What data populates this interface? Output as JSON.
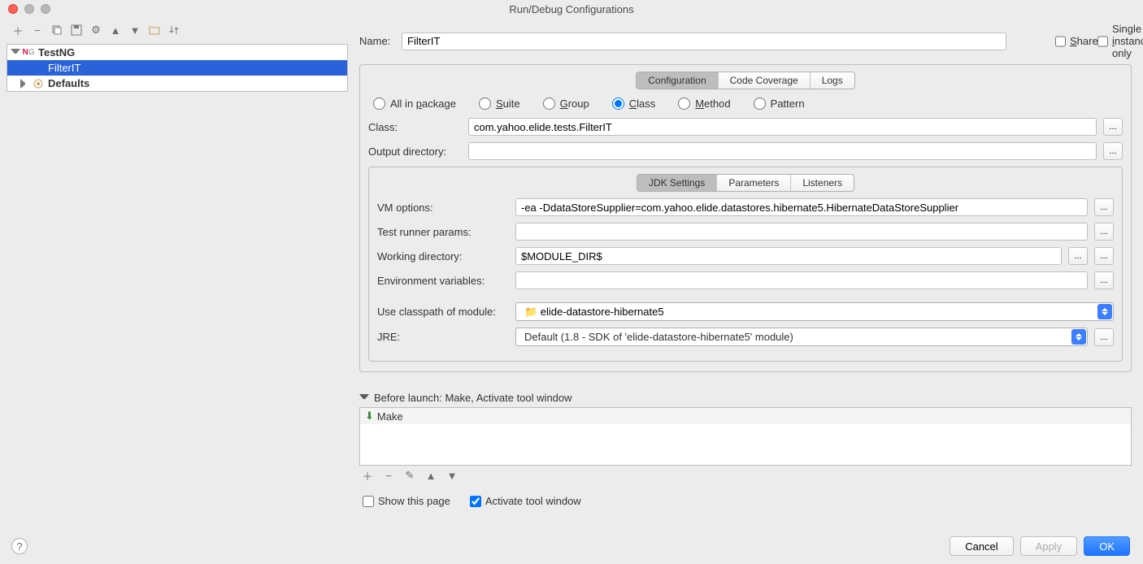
{
  "window": {
    "title": "Run/Debug Configurations"
  },
  "toolbar": {
    "share_label": "Share",
    "single_instance_label": "Single instance only"
  },
  "tree": {
    "root_label": "TestNG",
    "selected_label": "FilterIT",
    "defaults_label": "Defaults"
  },
  "form": {
    "name_label": "Name:",
    "name_value": "FilterIT",
    "tabs": {
      "configuration": "Configuration",
      "code_coverage": "Code Coverage",
      "logs": "Logs"
    },
    "test_kind": {
      "all_in_package": "All in package",
      "suite": "Suite",
      "group": "Group",
      "class": "Class",
      "method": "Method",
      "pattern": "Pattern"
    },
    "class_label": "Class:",
    "class_value": "com.yahoo.elide.tests.FilterIT",
    "output_dir_label": "Output directory:",
    "output_dir_value": "",
    "inner_tabs": {
      "jdk": "JDK Settings",
      "parameters": "Parameters",
      "listeners": "Listeners"
    },
    "vm_label": "VM options:",
    "vm_value": "-ea -DdataStoreSupplier=com.yahoo.elide.datastores.hibernate5.HibernateDataStoreSupplier",
    "runner_label": "Test runner params:",
    "runner_value": "",
    "workdir_label": "Working directory:",
    "workdir_value": "$MODULE_DIR$",
    "env_label": "Environment variables:",
    "env_value": "",
    "classpath_label": "Use classpath of module:",
    "classpath_value": "elide-datastore-hibernate5",
    "jre_label": "JRE:",
    "jre_value": "Default (1.8 - SDK of 'elide-datastore-hibernate5' module)"
  },
  "before_launch": {
    "header": "Before launch: Make, Activate tool window",
    "item": "Make"
  },
  "checks": {
    "show_page": "Show this page",
    "activate": "Activate tool window"
  },
  "buttons": {
    "cancel": "Cancel",
    "apply": "Apply",
    "ok": "OK"
  }
}
